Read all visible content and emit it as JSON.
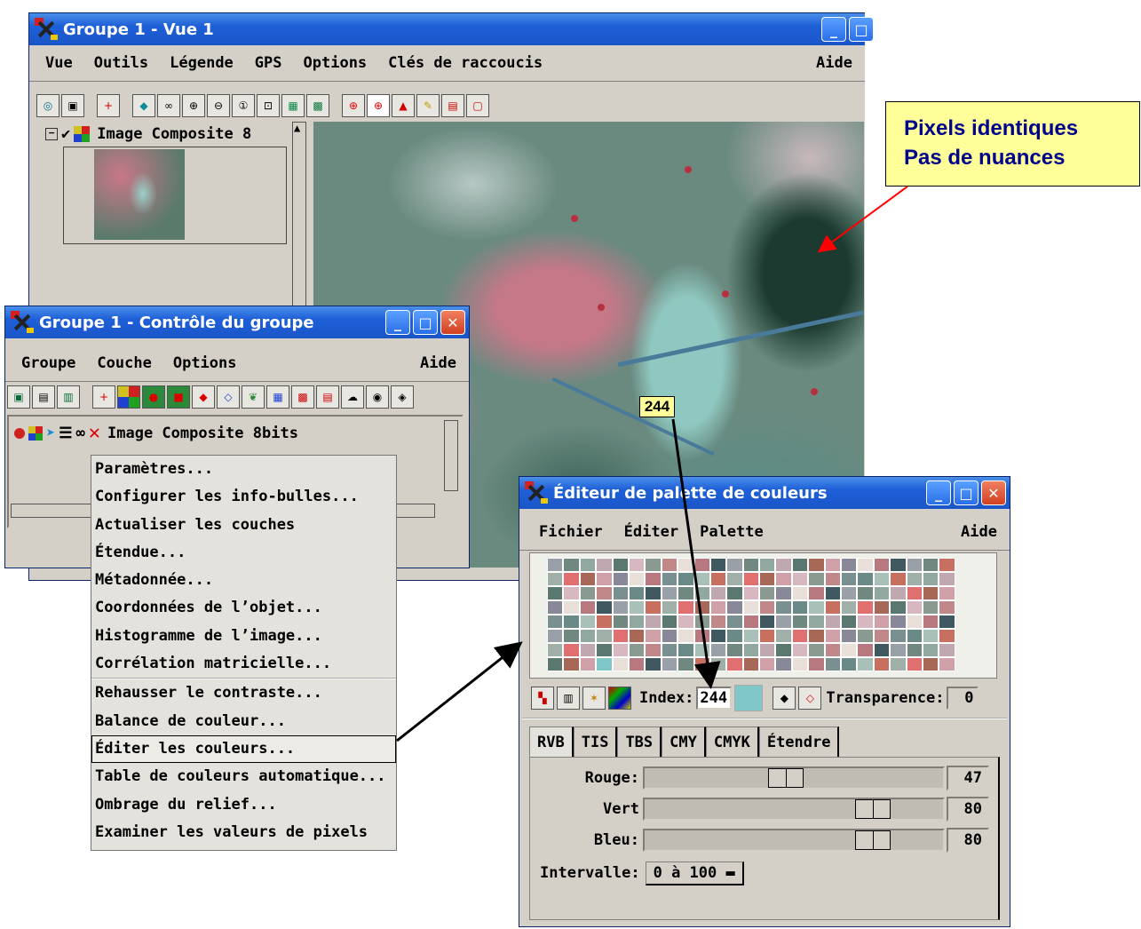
{
  "vue_window": {
    "title": "Groupe 1 - Vue 1",
    "menu": [
      "Vue",
      "Outils",
      "Légende",
      "GPS",
      "Options",
      "Clés de raccoucis"
    ],
    "menu_help": "Aide",
    "layer_label": "Image Composite 8"
  },
  "group_window": {
    "title": "Groupe 1 - Contrôle du groupe",
    "menu": [
      "Groupe",
      "Couche",
      "Options"
    ],
    "menu_help": "Aide",
    "layer_label": "Image Composite 8bits"
  },
  "context_menu": {
    "items": [
      "Paramètres...",
      "Configurer les info-bulles...",
      "Actualiser les couches",
      "Étendue...",
      "Métadonnée...",
      "Coordonnées de l’objet...",
      "Histogramme de l’image...",
      "Corrélation matricielle...",
      "Rehausser le contraste...",
      "Balance de couleur...",
      "Éditer les couleurs...",
      "Table de couleurs automatique...",
      "Ombrage du relief...",
      "Examiner les valeurs de pixels"
    ],
    "highlighted_index": 10
  },
  "callout": {
    "line1": "Pixels identiques",
    "line2": "Pas de nuances"
  },
  "pixel_tag": "244",
  "palette_window": {
    "title": "Éditeur de palette de couleurs",
    "menu": [
      "Fichier",
      "Éditer",
      "Palette"
    ],
    "menu_help": "Aide",
    "index_label": "Index:",
    "index_value": "244",
    "selected_color": "#80c8c8",
    "transparency_label": "Transparence:",
    "transparency_value": "0",
    "tabs": [
      "RVB",
      "TIS",
      "TBS",
      "CMY",
      "CMYK",
      "Étendre"
    ],
    "sliders": [
      {
        "label": "Rouge:",
        "value": "47",
        "level": 0.47
      },
      {
        "label": "Vert",
        "value": "80",
        "level": 0.8
      },
      {
        "label": "Bleu:",
        "value": "80",
        "level": 0.8
      }
    ],
    "interval_label": "Intervalle:",
    "interval_value": "0 à 100"
  },
  "colors": {
    "title_bar": "#1e5fd8",
    "window_bg": "#d4d0c8",
    "callout_bg": "#ffff99",
    "callout_text": "#00008b",
    "pointer_red": "#ff0000"
  }
}
